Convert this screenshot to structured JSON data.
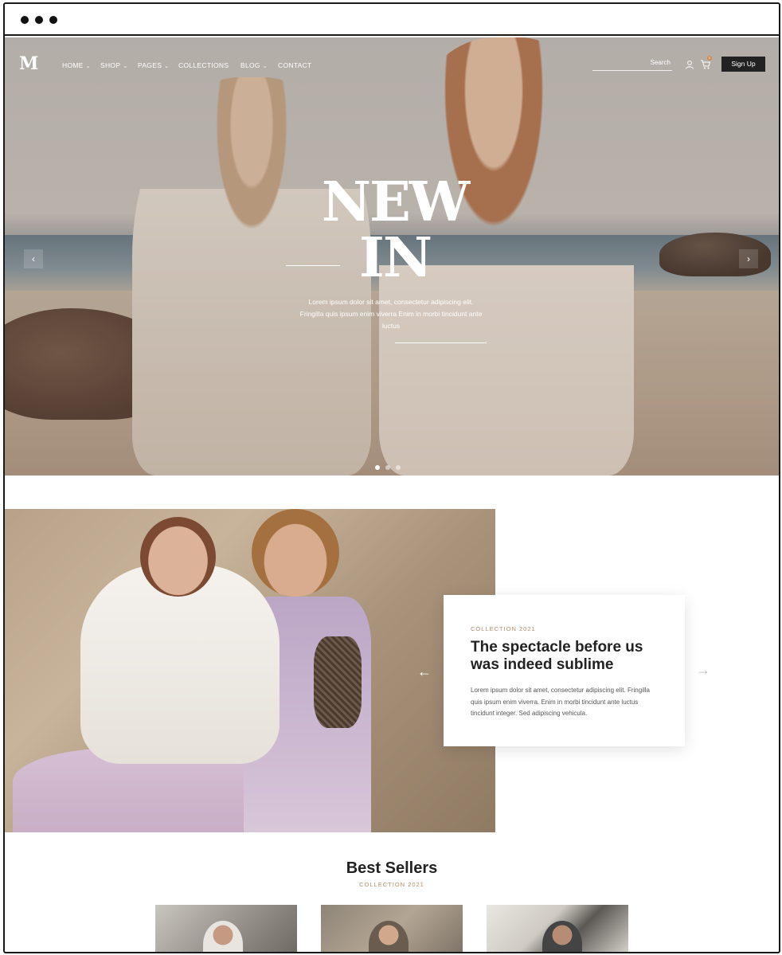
{
  "nav": {
    "logo": "M",
    "items": [
      {
        "label": "HOME",
        "has_dropdown": true
      },
      {
        "label": "SHOP",
        "has_dropdown": true
      },
      {
        "label": "PAGES",
        "has_dropdown": true
      },
      {
        "label": "COLLECTIONS",
        "has_dropdown": false
      },
      {
        "label": "BLOG",
        "has_dropdown": true
      },
      {
        "label": "CONTACT",
        "has_dropdown": false
      }
    ],
    "search_placeholder": "Search",
    "cart_count": "0",
    "signup_label": "Sign Up"
  },
  "hero": {
    "headline_line1": "NEW",
    "headline_line2": "IN",
    "text": "Lorem ipsum dolor sit amet, consectetur adipiscing elit. Fringilla quis ipsum enim viverra Enim in morbi tincidunt ante luctus",
    "prev_icon": "chevron-left-icon",
    "next_icon": "chevron-right-icon",
    "slides_total": 3,
    "slide_active": 1
  },
  "collection": {
    "eyebrow": "COLLECTION 2021",
    "title": "The spectacle before us was indeed sublime",
    "text": "Lorem ipsum dolor sit amet, consectetur adipiscing elit. Fringilla quis ipsum enim viverra. Enim in morbi tincidunt ante luctus tincidunt integer. Sed adipiscing vehicula.",
    "prev_arrow": "←",
    "next_arrow": "→"
  },
  "best_sellers": {
    "title": "Best Sellers",
    "subtitle": "COLLECTION 2021"
  },
  "colors": {
    "accent": "#b08d6a",
    "button_dark": "#222222"
  }
}
